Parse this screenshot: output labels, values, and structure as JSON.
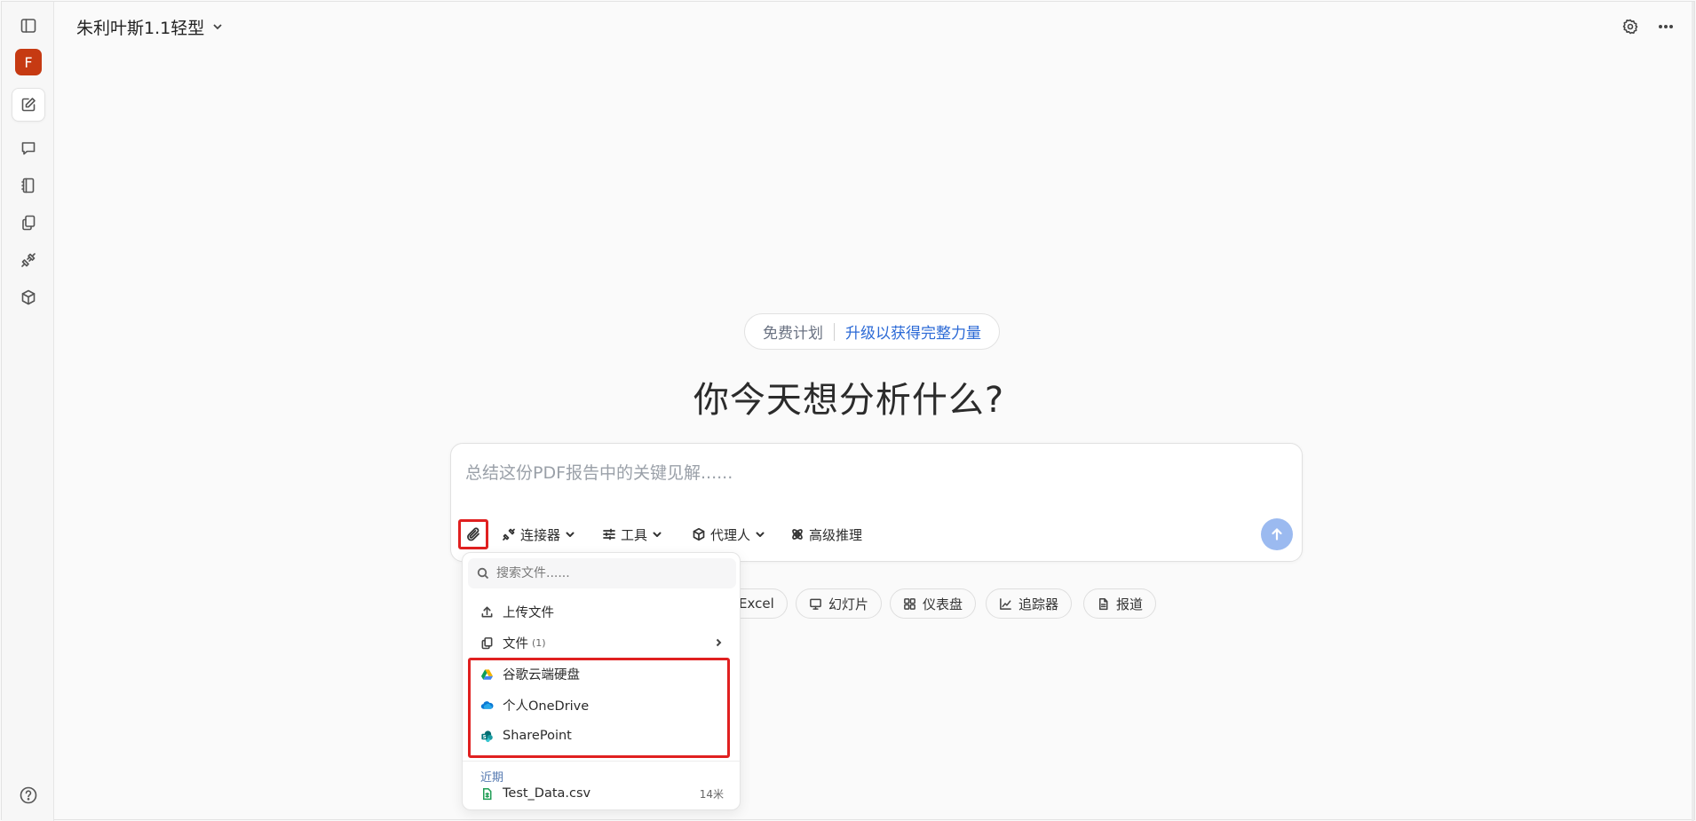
{
  "header": {
    "model_name": "朱利叶斯1.1轻型",
    "icons": [
      "chevron-down-icon",
      "gear-icon",
      "more-horizontal-icon"
    ]
  },
  "sidebar": {
    "avatar_letter": "F",
    "items": [
      {
        "name": "sidebar-toggle-icon"
      },
      {
        "name": "new-chat-icon"
      },
      {
        "name": "chat-icon"
      },
      {
        "name": "notebook-icon"
      },
      {
        "name": "files-icon"
      },
      {
        "name": "connector-icon"
      },
      {
        "name": "cube-icon"
      }
    ],
    "help_icon": "help-circle-icon"
  },
  "plan": {
    "free_label": "免费计划",
    "upgrade_label": "升级以获得完整力量"
  },
  "main": {
    "headline": "你今天想分析什么?"
  },
  "composer": {
    "placeholder": "总结这份PDF报告中的关键见解......",
    "attach_icon": "paperclip-icon",
    "toolbar": {
      "connectors_label": "连接器",
      "tools_label": "工具",
      "agent_label": "代理人",
      "advanced_label": "高级推理"
    },
    "send_icon": "arrow-up-icon"
  },
  "chips": [
    {
      "label": "Excel",
      "icon": "spreadsheet-icon"
    },
    {
      "label": "幻灯片",
      "icon": "presentation-icon"
    },
    {
      "label": "仪表盘",
      "icon": "dashboard-icon"
    },
    {
      "label": "追踪器",
      "icon": "trend-icon"
    },
    {
      "label": "报道",
      "icon": "document-icon"
    }
  ],
  "dropdown": {
    "search_placeholder": "搜索文件......",
    "upload_label": "上传文件",
    "files_label": "文件",
    "files_count": "(1)",
    "google_drive_label": "谷歌云端硬盘",
    "onedrive_label": "个人OneDrive",
    "sharepoint_label": "SharePoint",
    "recent_section": "近期",
    "recent_file": {
      "name": "Test_Data.csv",
      "size": "14米"
    }
  },
  "colors": {
    "accent": "#2c6ad6",
    "avatar": "#c63a12",
    "send_button": "#9bbaf0",
    "highlight": "#e02020"
  }
}
